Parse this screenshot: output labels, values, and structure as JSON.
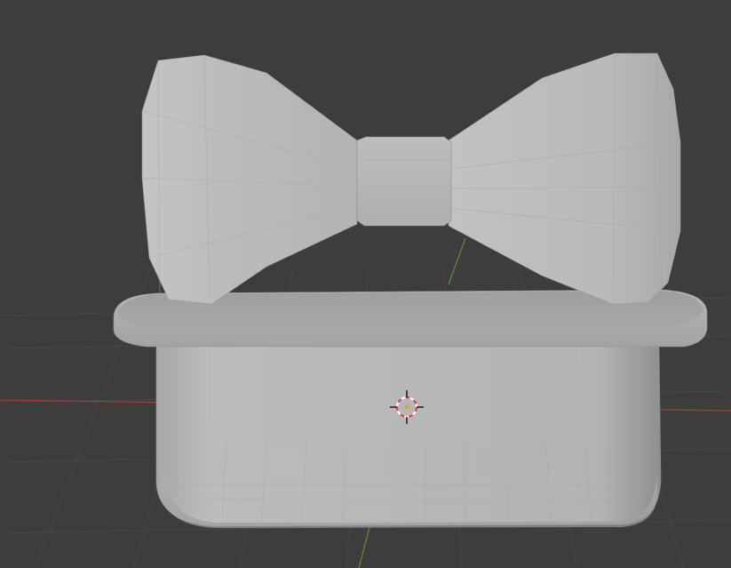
{
  "app": {
    "name": "3D viewport"
  },
  "viewport": {
    "background_color": "#3d3d3d",
    "grid_color": "#4a4a4a",
    "x_axis_color": "#b84040",
    "y_axis_color": "#6a9a2a"
  },
  "scene": {
    "objects": [
      {
        "name": "bow-tie",
        "shading": "solid",
        "color": "#b8b8b8"
      },
      {
        "name": "lid",
        "shading": "solid",
        "color": "#a9a9a9"
      },
      {
        "name": "base",
        "shading": "solid",
        "color": "#b3b3b3"
      }
    ]
  },
  "cursor_3d": {
    "icon": "crosshair-target-icon",
    "ring_colors": [
      "#e04040",
      "#ffffff"
    ]
  }
}
